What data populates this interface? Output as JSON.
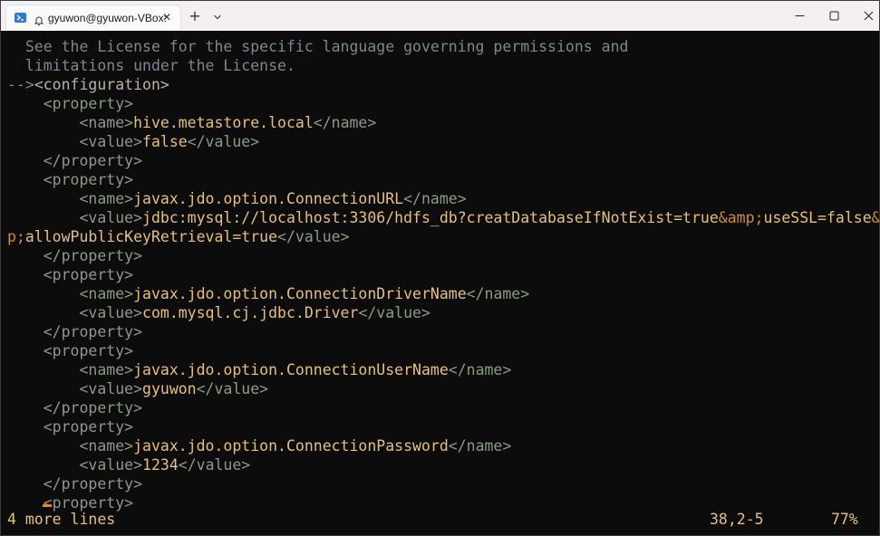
{
  "titlebar": {
    "tab_title": "gyuwon@gyuwon-VBox:",
    "icons": {
      "shell": "powershell-icon",
      "bell": "bell-icon",
      "close": "close-icon",
      "new_tab": "plus-icon",
      "dropdown": "chevron-down-icon",
      "minimize": "minimize-icon",
      "maximize": "maximize-icon",
      "close_window": "close-icon"
    },
    "close_glyph": "✕",
    "new_tab_glyph": "+"
  },
  "terminal": {
    "lines": [
      {
        "t1": "  See the License for the specific language governing permissions and"
      },
      {
        "t1": "  limitations under the License."
      },
      {
        "t1": "-->",
        "t2": "<configuration>"
      },
      {
        "t1": "    <property>"
      },
      {
        "t1": "        <name>",
        "t2": "hive.metastore.local",
        "t3": "</name>"
      },
      {
        "t1": "        <value>",
        "t2": "false",
        "t3": "</value>"
      },
      {
        "t1": "    </property>"
      },
      {
        "t1": "    <property>"
      },
      {
        "t1": "        <name>",
        "t2": "javax.jdo.option.ConnectionURL",
        "t3": "</name>"
      },
      {
        "t1": "        <value>",
        "t2": "jdbc:mysql://localhost:3306/hdfs_db?creatDatabaseIfNotExist=true",
        "t3": "&amp;",
        "t4": "useSSL=false",
        "t5": "&am"
      },
      {
        "t1": "p;",
        "t2": "allowPublicKeyRetrieval=true",
        "t3": "</value>"
      },
      {
        "t1": "    </property>"
      },
      {
        "t1": "    <property>"
      },
      {
        "t1": "        <name>",
        "t2": "javax.jdo.option.ConnectionDriverName",
        "t3": "</name>"
      },
      {
        "t1": "        <value>",
        "t2": "com.mysql.cj.jdbc.Driver",
        "t3": "</value>"
      },
      {
        "t1": "    </property>"
      },
      {
        "t1": "    <property>"
      },
      {
        "t1": "        <name>",
        "t2": "javax.jdo.option.ConnectionUserName",
        "t3": "</name>"
      },
      {
        "t1": "        <value>",
        "t2": "gyuwon",
        "t3": "</value>"
      },
      {
        "t1": "    </property>"
      },
      {
        "t1": "    <property>"
      },
      {
        "t1": "        <name>",
        "t2": "javax.jdo.option.ConnectionPassword",
        "t3": "</name>"
      },
      {
        "t1": "        <value>",
        "t2": "1234",
        "t3": "</value>"
      },
      {
        "t1": "    </property>"
      },
      {
        "t1": "    <property>"
      }
    ],
    "status": {
      "message": "4 more lines",
      "position": "38,2-5",
      "percent": "77%"
    },
    "colors": {
      "background": "#0c0c0c",
      "tag": "#8b9a86",
      "text": "#e5c07b",
      "entity": "#d08a3a",
      "comment": "#7f868e",
      "cursor": "#ff7a1a"
    }
  }
}
